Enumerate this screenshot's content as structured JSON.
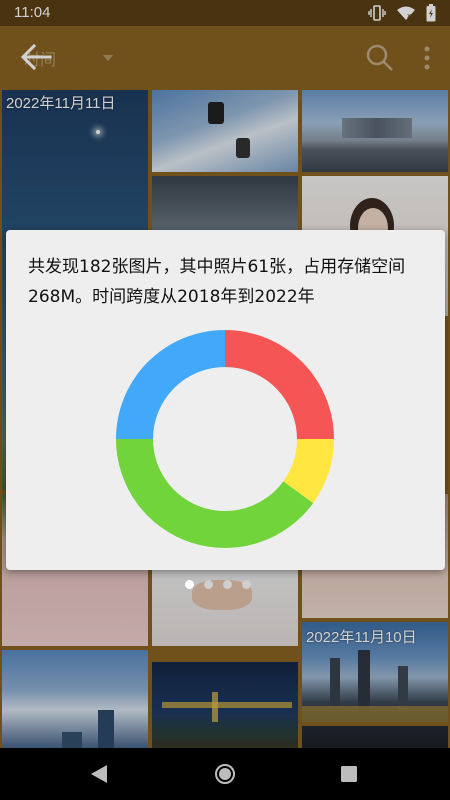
{
  "status_bar": {
    "time": "11:04",
    "icons": [
      "vibrate-icon",
      "wifi-icon",
      "battery-icon"
    ]
  },
  "app_bar": {
    "title": "时间",
    "icons": [
      "back-arrow-icon",
      "dropdown-arrow-icon",
      "search-icon",
      "more-vert-icon"
    ]
  },
  "gallery": {
    "date_labels": [
      "2022年11月11日",
      "2022年11月10日"
    ]
  },
  "dialog": {
    "summary": "共发现182张图片，其中照片61张，占用存储空间268M。时间跨度从2018年到2022年"
  },
  "chart_data": {
    "type": "pie",
    "style": "donut",
    "slices": [
      {
        "color": "#f55555",
        "fraction": 0.25
      },
      {
        "color": "#ffe640",
        "fraction": 0.1
      },
      {
        "color": "#70d43a",
        "fraction": 0.4
      },
      {
        "color": "#42a8f9",
        "fraction": 0.25
      }
    ]
  },
  "pager": {
    "count": 4,
    "active_index": 0
  },
  "nav_bar": {
    "icons": [
      "nav-back-icon",
      "nav-home-icon",
      "nav-recents-icon"
    ]
  }
}
